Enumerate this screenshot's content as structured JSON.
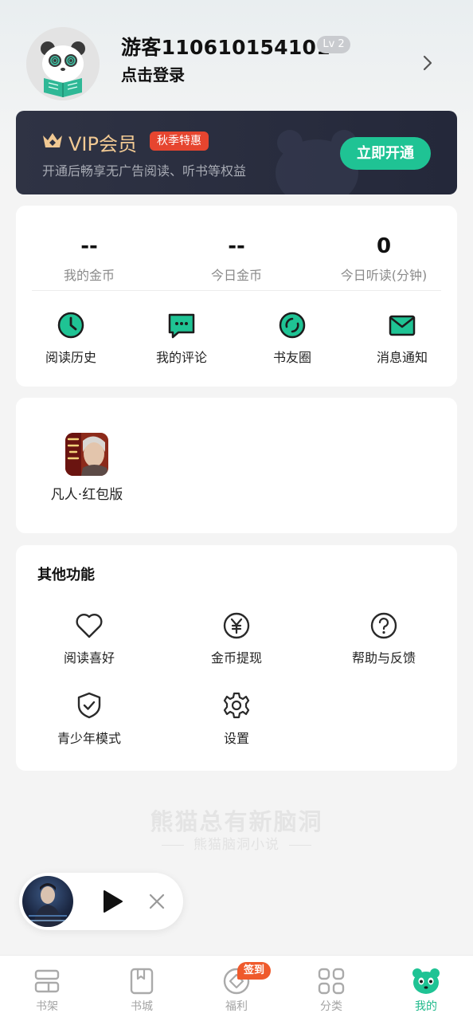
{
  "profile": {
    "username": "游客110610154101",
    "level": "Lv 2",
    "login_text": "点击登录",
    "icons": {
      "avatar": "panda-reading-avatar",
      "chevron": "chevron-right-icon"
    }
  },
  "vip": {
    "title": "VIP会员",
    "badge": "秋季特惠",
    "subtitle": "开通后畅享无广告阅读、听书等权益",
    "button": "立即开通",
    "colors": {
      "title": "#f1c993",
      "badge": "#e6452f",
      "button": "#1fc394",
      "background": "#2a2e40"
    }
  },
  "stats": [
    {
      "value": "--",
      "label": "我的金币"
    },
    {
      "value": "--",
      "label": "今日金币"
    },
    {
      "value": "0",
      "label": "今日听读(分钟)"
    }
  ],
  "quick_links": [
    {
      "label": "阅读历史",
      "icon": "clock-icon"
    },
    {
      "label": "我的评论",
      "icon": "comment-icon"
    },
    {
      "label": "书友圈",
      "icon": "circle-icon"
    },
    {
      "label": "消息通知",
      "icon": "mail-icon"
    }
  ],
  "promo": {
    "label": "凡人·红包版",
    "icon": "game-thumbnail"
  },
  "other": {
    "title": "其他功能",
    "items": [
      {
        "label": "阅读喜好",
        "icon": "heart-icon"
      },
      {
        "label": "金币提现",
        "icon": "yen-coin-icon"
      },
      {
        "label": "帮助与反馈",
        "icon": "help-icon"
      },
      {
        "label": "青少年模式",
        "icon": "shield-check-icon"
      },
      {
        "label": "设置",
        "icon": "gear-icon"
      }
    ]
  },
  "watermark": {
    "main": "熊猫总有新脑洞",
    "sub": "熊猫脑洞小说"
  },
  "mini_player": {
    "icons": [
      "book-cover",
      "play-icon",
      "close-icon"
    ]
  },
  "nav": {
    "signin_badge": "签到",
    "items": [
      {
        "label": "书架",
        "icon": "bookshelf-icon"
      },
      {
        "label": "书城",
        "icon": "bookstore-icon"
      },
      {
        "label": "福利",
        "icon": "welfare-icon"
      },
      {
        "label": "分类",
        "icon": "category-grid-icon"
      },
      {
        "label": "我的",
        "icon": "panda-icon",
        "active": true
      }
    ],
    "colors": {
      "active": "#1fb98b",
      "inactive": "#a4a4a4"
    }
  }
}
